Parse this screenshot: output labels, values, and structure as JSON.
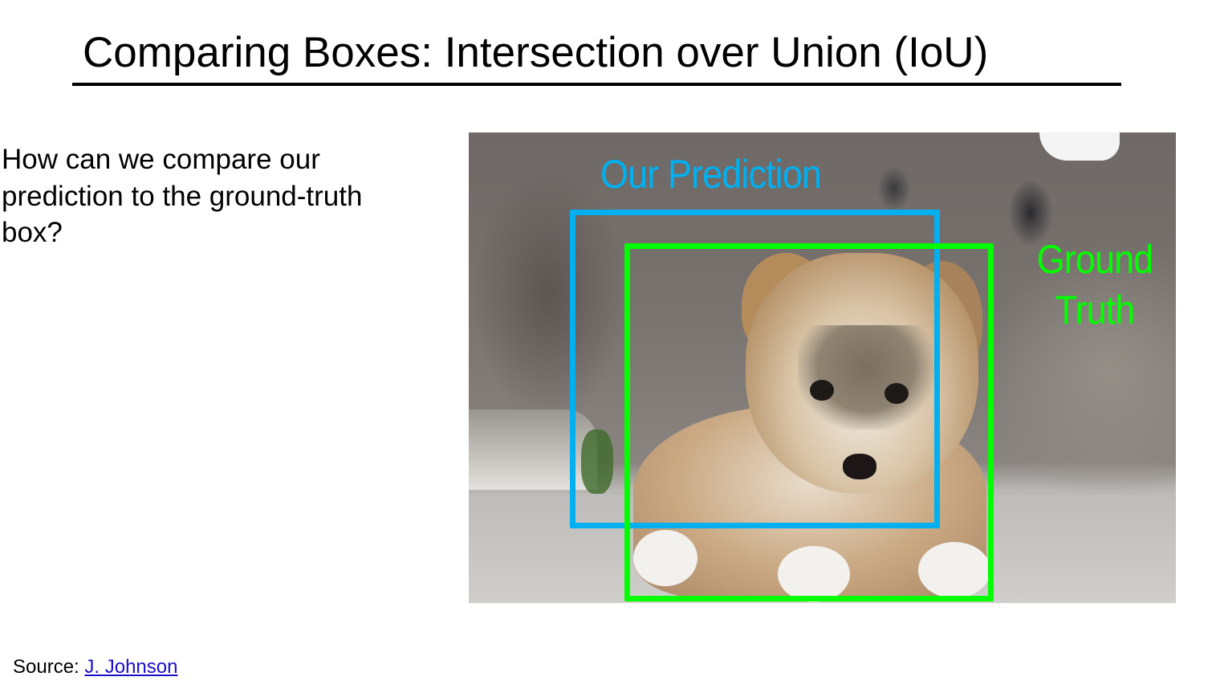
{
  "slide": {
    "title": "Comparing Boxes: Intersection over Union (IoU)",
    "body": "How can we compare our prediction to the ground-truth box?",
    "image": {
      "prediction_label": "Our Prediction",
      "ground_truth_label_line1": "Ground",
      "ground_truth_label_line2": "Truth",
      "prediction_color": "#00b0f0",
      "ground_truth_color": "#00ff00"
    },
    "source": {
      "prefix": "Source: ",
      "link_text": "J. Johnson"
    }
  }
}
